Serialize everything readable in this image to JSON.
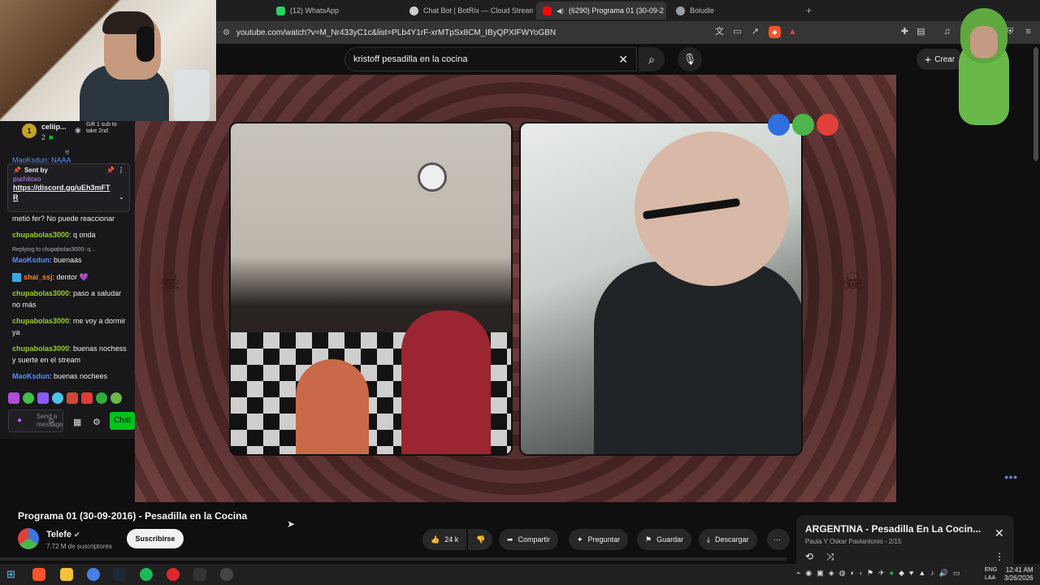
{
  "browser": {
    "tabs": [
      {
        "label": "(12) WhatsApp",
        "icon": "whatsapp-icon",
        "color": "#25d366"
      },
      {
        "label": "Chat Bot | BotRix — Cloud Streaming",
        "icon": "chat-bot-icon",
        "color": "#cfcfcf"
      },
      {
        "label": "(6290) Programa 01 (30-09-2",
        "icon": "youtube-icon",
        "color": "#ff0000"
      },
      {
        "label": "Boludle",
        "icon": "globe-icon",
        "color": "#9aa0a6"
      }
    ],
    "url": "youtube.com/watch?v=M_Nr433yC1c&list=PLb4Y1rF-xrMTpSx8CM_IByQPXIFWYoGBN"
  },
  "youtube": {
    "search_query": "kristoff pesadilla en la cocina",
    "create_label": "Crear",
    "video_title": "Programa 01 (30-09-2016) - Pesadilla en la Cocina",
    "channel_name": "Telefe",
    "subscribers": "7.72 M de suscriptores",
    "subscribe_label": "Suscribirse",
    "likes": "24 k",
    "share_label": "Compartir",
    "ask_label": "Preguntar",
    "save_label": "Guardar",
    "download_label": "Descargar"
  },
  "playlist": {
    "title": "ARGENTINA - Pesadilla En La Cocin...",
    "subtitle": "Paula Y Oskar Paolantonio - 2/15"
  },
  "chat": {
    "top_user": "celiip...",
    "top_user_count": "2",
    "gift_text": "Gift 1 sub to take 2nd",
    "partial_top": "MaoKsdun: NAAA",
    "pinned_sent_by": "Sent by",
    "pinned_user": "puchitoxo",
    "pinned_link": "https://discord.gg/uEh3mFTR",
    "messages": [
      {
        "user": "",
        "text": "metió fer? No puede reaccionar",
        "color": "#efeff1"
      },
      {
        "user": "chupabolas3000",
        "text": ": q onda",
        "color": "#9acd32"
      },
      {
        "user": "",
        "text": "Replying to chupabolas3000: q...",
        "color": "#adadb8"
      },
      {
        "user": "MaoKsdun",
        "text": ": buenaas",
        "color": "#5b8cff"
      },
      {
        "user": "shai_ssj",
        "text": ": dentor 💜",
        "color": "#ff7f24"
      },
      {
        "user": "chupabolas3000",
        "text": ": paso a saludar no más",
        "color": "#9acd32"
      },
      {
        "user": "chupabolas3000",
        "text": ": me voy a dormir ya",
        "color": "#9acd32"
      },
      {
        "user": "chupabolas3000",
        "text": ": buenas nochess y suerte en el stream",
        "color": "#9acd32"
      },
      {
        "user": "MaoKsdun",
        "text": ": buenas nochees",
        "color": "#5b8cff"
      }
    ],
    "input_placeholder": "Send a message",
    "chat_button": "Chat"
  },
  "taskbar": {
    "lang": "ENG",
    "lang_sub": "LAA",
    "time": "12:41 AM",
    "date": "3/26/2026"
  }
}
